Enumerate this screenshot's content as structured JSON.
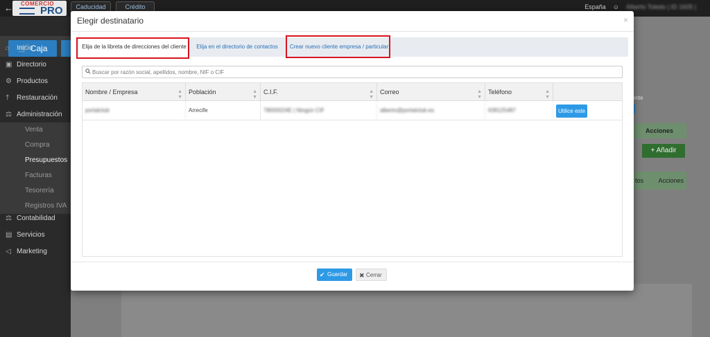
{
  "app": {
    "back_icon": "arrow-left-icon",
    "logo_top": "COMERCIO",
    "logo_bottom": "PRO",
    "top_tabs": [
      "Caducidad",
      "Crédito"
    ],
    "lang": "España",
    "user": "Alberto Toledo | ID 1605 |"
  },
  "sidebar": {
    "caja_label": "Caja",
    "items": [
      {
        "label": "Inicio",
        "icon": "home-icon"
      },
      {
        "label": "Directorio",
        "icon": "book-icon"
      },
      {
        "label": "Productos",
        "icon": "gear-icon"
      },
      {
        "label": "Restauración",
        "icon": "cutlery-icon"
      },
      {
        "label": "Administración",
        "icon": "scale-icon"
      }
    ],
    "subitems": [
      "Venta",
      "Compra",
      "Presupuestos",
      "Facturas",
      "Tesorería",
      "Registros IVA"
    ],
    "items2": [
      {
        "label": "Contabilidad",
        "icon": "balance-icon"
      },
      {
        "label": "Servicios",
        "icon": "briefcase-icon"
      },
      {
        "label": "Marketing",
        "icon": "megaphone-icon"
      }
    ]
  },
  "background": {
    "ente_text": "ente",
    "acciones_label": "Acciones",
    "add_label": "Añadir",
    "row_left": "tos",
    "row_right": "Acciones"
  },
  "modal": {
    "title": "Elegir destinatario",
    "close_icon": "close-icon",
    "tabs": [
      "Elija de la libreta de direcciones del cliente",
      "Elija en el directorio de contactos",
      "Crear nuevo cliente empresa / particular"
    ],
    "search_placeholder": "Buscar por razón social, apellidos, nombre, NIF o CIF",
    "columns": [
      "Nombre / Empresa",
      "Población",
      "C.I.F.",
      "Correo",
      "Teléfono",
      ""
    ],
    "rows": [
      {
        "name": "portalclub",
        "city": "Arrecife",
        "cif": "78000024E | Ningún CIF",
        "email": "alberto@portalclub.es",
        "phone": "639125487",
        "action": "Utilice este"
      }
    ],
    "save_label": "Guardar",
    "cancel_label": "Cerrar"
  },
  "colors": {
    "accent": "#2e9ae6",
    "highlight": "#d9131e",
    "link": "#2a6fb4"
  }
}
